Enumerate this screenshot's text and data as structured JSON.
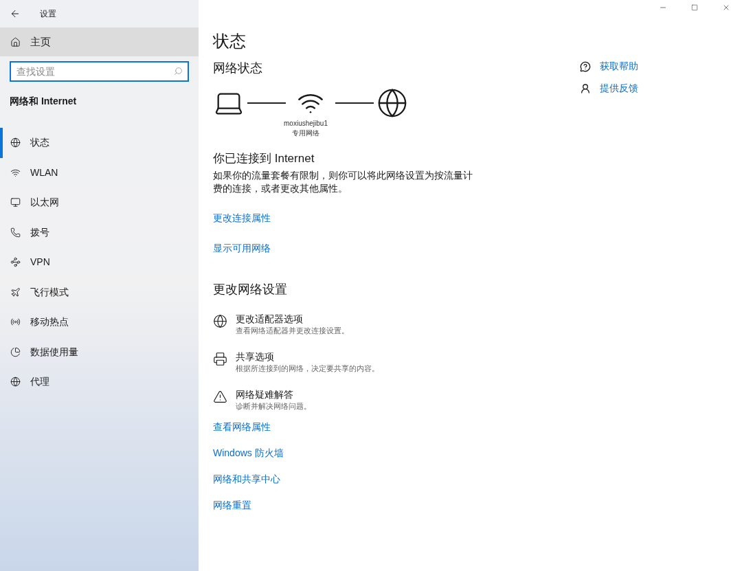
{
  "window": {
    "title": "设置"
  },
  "sidebar": {
    "home": "主页",
    "search": {
      "placeholder": "查找设置"
    },
    "section_title": "网络和 Internet",
    "items": [
      {
        "kind": "status",
        "label": "状态",
        "selected": true
      },
      {
        "kind": "wlan",
        "label": "WLAN",
        "selected": false
      },
      {
        "kind": "ethernet",
        "label": "以太网",
        "selected": false
      },
      {
        "kind": "dialup",
        "label": "拨号",
        "selected": false
      },
      {
        "kind": "vpn",
        "label": "VPN",
        "selected": false
      },
      {
        "kind": "airplane",
        "label": "飞行模式",
        "selected": false
      },
      {
        "kind": "hotspot",
        "label": "移动热点",
        "selected": false
      },
      {
        "kind": "data",
        "label": "数据使用量",
        "selected": false
      },
      {
        "kind": "proxy",
        "label": "代理",
        "selected": false
      }
    ]
  },
  "main": {
    "title": "状态",
    "network_status": {
      "heading": "网络状态",
      "network_name": "moxiushejibu1",
      "network_type": "专用网络"
    },
    "connected_heading": "你已连接到 Internet",
    "connected_text": "如果你的流量套餐有限制，则你可以将此网络设置为按流量计费的连接，或者更改其他属性。",
    "links": [
      "更改连接属性",
      "显示可用网络"
    ],
    "change_heading": "更改网络设置",
    "options": [
      {
        "kind": "adapter",
        "title": "更改适配器选项",
        "description": "查看网络适配器并更改连接设置。"
      },
      {
        "kind": "sharing",
        "title": "共享选项",
        "description": "根据所连接到的网络，决定要共享的内容。"
      },
      {
        "kind": "troubleshoot",
        "title": "网络疑难解答",
        "description": "诊断并解决网络问题。"
      }
    ],
    "bottom_links": [
      "查看网络属性",
      "Windows 防火墙",
      "网络和共享中心",
      "网络重置"
    ]
  },
  "help_links": [
    {
      "kind": "help",
      "label": "获取帮助"
    },
    {
      "kind": "feedback",
      "label": "提供反馈"
    }
  ]
}
